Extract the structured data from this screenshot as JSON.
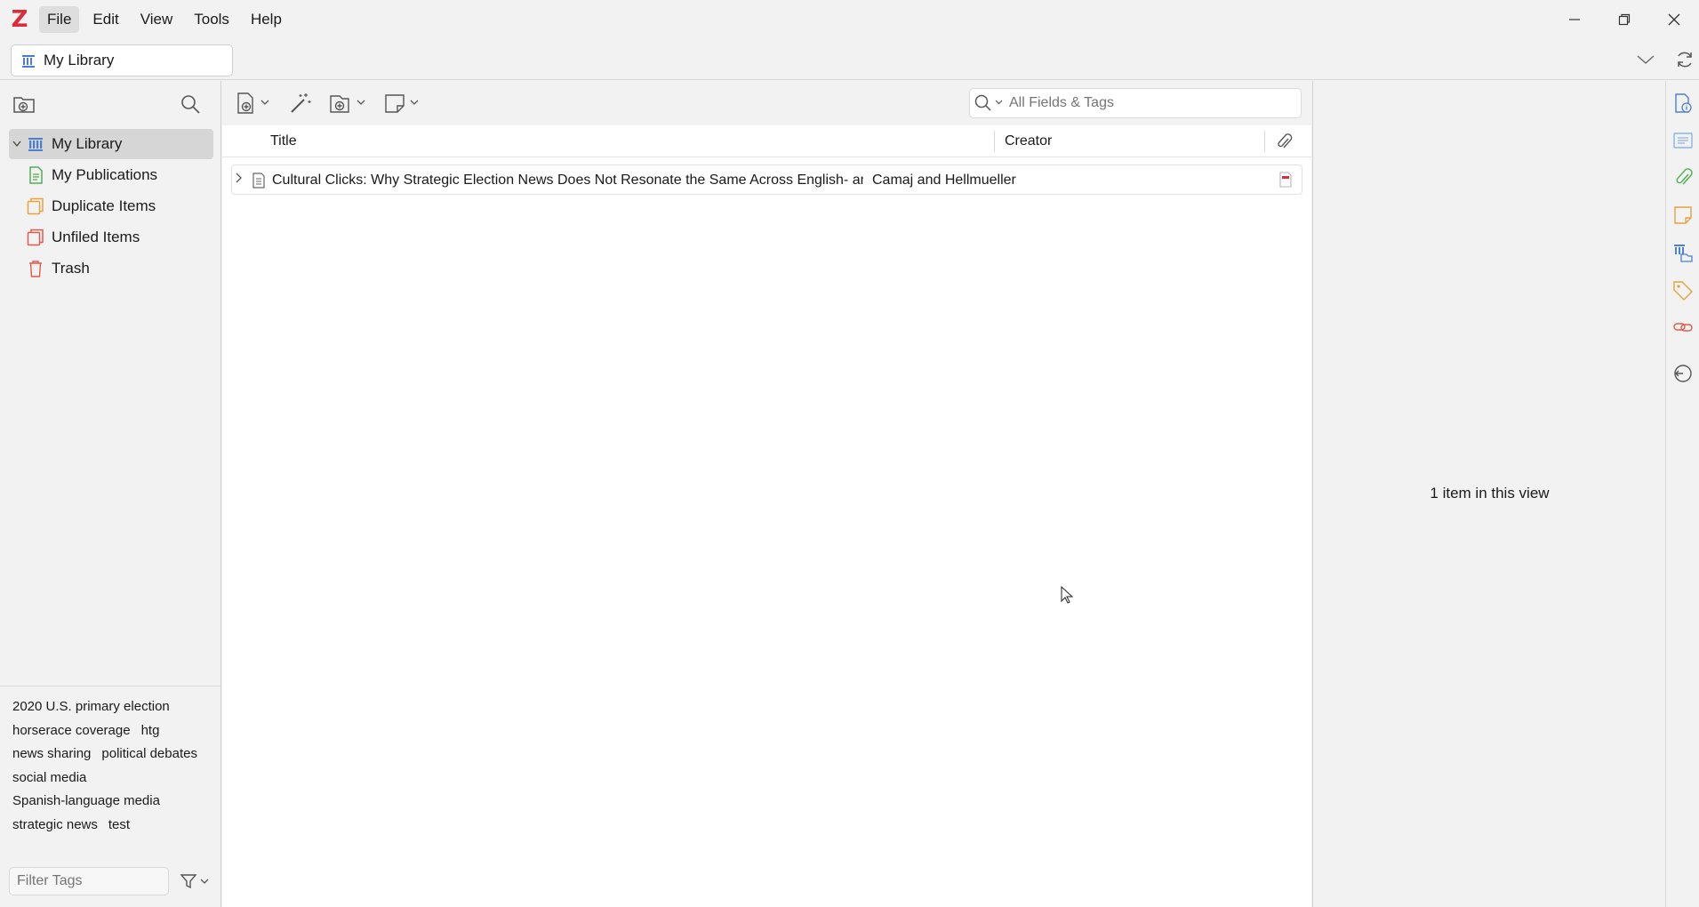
{
  "menubar": {
    "logo": "Z",
    "items": [
      {
        "label": "File",
        "active": true
      },
      {
        "label": "Edit",
        "active": false
      },
      {
        "label": "View",
        "active": false
      },
      {
        "label": "Tools",
        "active": false
      },
      {
        "label": "Help",
        "active": false
      }
    ]
  },
  "tabbar": {
    "library_tab": "My Library"
  },
  "collections": [
    {
      "label": "My Library",
      "icon": "library-icon",
      "selected": true
    },
    {
      "label": "My Publications",
      "icon": "publications-icon"
    },
    {
      "label": "Duplicate Items",
      "icon": "duplicate-icon"
    },
    {
      "label": "Unfiled Items",
      "icon": "unfiled-icon"
    },
    {
      "label": "Trash",
      "icon": "trash-icon"
    }
  ],
  "tags": [
    "2020 U.S. primary election",
    "horserace coverage",
    "htg",
    "news sharing",
    "political debates",
    "social media",
    "Spanish-language media",
    "strategic news",
    "test"
  ],
  "tag_filter": {
    "placeholder": "Filter Tags"
  },
  "search": {
    "placeholder": "All Fields & Tags"
  },
  "columns": {
    "title": "Title",
    "creator": "Creator"
  },
  "items": [
    {
      "title": "Cultural Clicks: Why Strategic Election News Does Not Resonate the Same Across English- and Spanish-Langua...",
      "creator": "Camaj and Hellmueller",
      "attachment": "pdf-icon"
    }
  ],
  "item_pane": {
    "message": "1 item in this view"
  },
  "colors": {
    "accent": "#db2c3a",
    "icon_blue": "#4a7fd4",
    "green": "#4caf50",
    "orange": "#e8a33d"
  }
}
